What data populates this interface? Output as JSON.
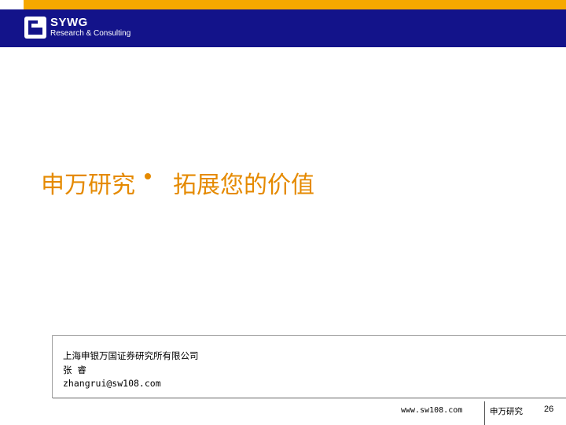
{
  "header": {
    "logo_name": "SYWG",
    "logo_tagline": "Research & Consulting",
    "colors": {
      "stripe": "#f6a800",
      "band": "#13138a"
    }
  },
  "title": {
    "left": "申万研究",
    "right": "拓展您的价值",
    "color": "#e58a00"
  },
  "contact": {
    "company": "上海申银万国证券研究所有限公司",
    "name": "张 睿",
    "email": "zhangrui@sw108.com"
  },
  "footer": {
    "url": "www.sw108.com",
    "brand": "申万研究",
    "page_number": "26"
  }
}
